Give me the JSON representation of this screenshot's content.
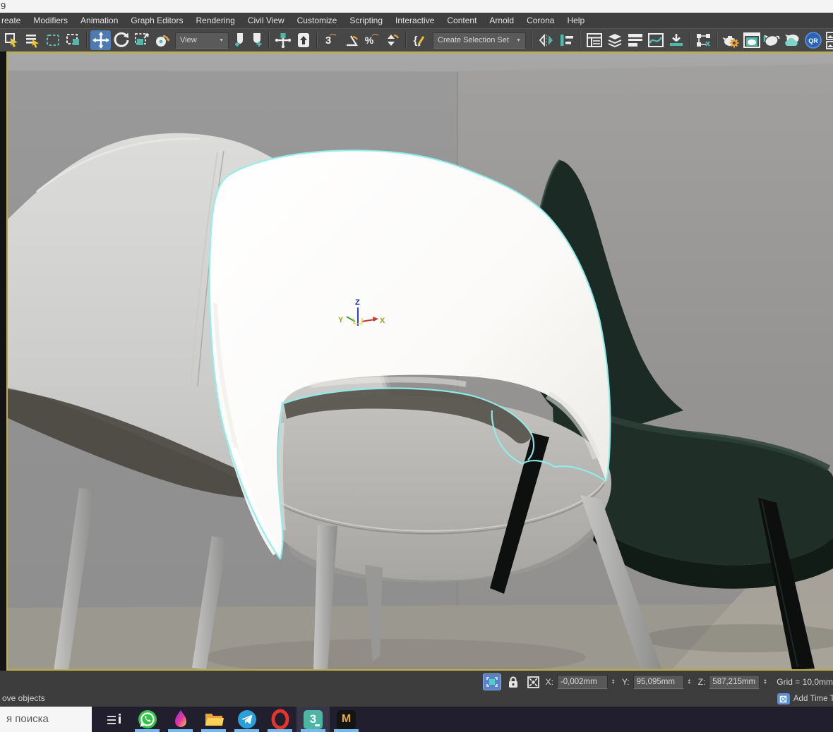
{
  "window": {
    "title": "9"
  },
  "menu": {
    "items": [
      "reate",
      "Modifiers",
      "Animation",
      "Graph Editors",
      "Rendering",
      "Civil View",
      "Customize",
      "Scripting",
      "Interactive",
      "Content",
      "Arnold",
      "Corona",
      "Help"
    ]
  },
  "toolbar": {
    "view_dropdown": "View",
    "selection_set_placeholder": "Create Selection Set",
    "icons": {
      "snap_3": "3",
      "percent": "%",
      "braces": "{",
      "qr": "QR",
      "dropdown_arrow": "▼",
      "spinner_up": "▲",
      "spinner_down": "▼"
    }
  },
  "viewport": {
    "gizmo": {
      "x": "X",
      "y": "Y",
      "z": "Z"
    }
  },
  "status_bar": {
    "prompt": "ove objects",
    "coords": {
      "x_label": "X:",
      "x_value": "-0,002mm",
      "y_label": "Y:",
      "y_value": "95,095mm",
      "z_label": "Z:",
      "z_value": "587,215mm"
    },
    "grid": "Grid = 10,0mm",
    "add_time_tag": "Add Time Tag"
  },
  "taskbar": {
    "search_text": "я поиска",
    "apps": [
      {
        "name": "task-view"
      },
      {
        "name": "whatsapp"
      },
      {
        "name": "paint-drop"
      },
      {
        "name": "file-explorer"
      },
      {
        "name": "telegram"
      },
      {
        "name": "opera"
      },
      {
        "name": "3ds-max",
        "label": "3",
        "active": true
      },
      {
        "name": "m-app",
        "label": "M"
      }
    ]
  },
  "colors": {
    "selection_outline": "#8feeea",
    "accent_teal": "#4fb9ab",
    "active_tool_blue": "#4e7cb0",
    "viewport_border": "#bfae46",
    "taskbar_underline": "#76b9ed",
    "green_chair": "#1f2f28",
    "white_chair": "#f7f6f3"
  }
}
